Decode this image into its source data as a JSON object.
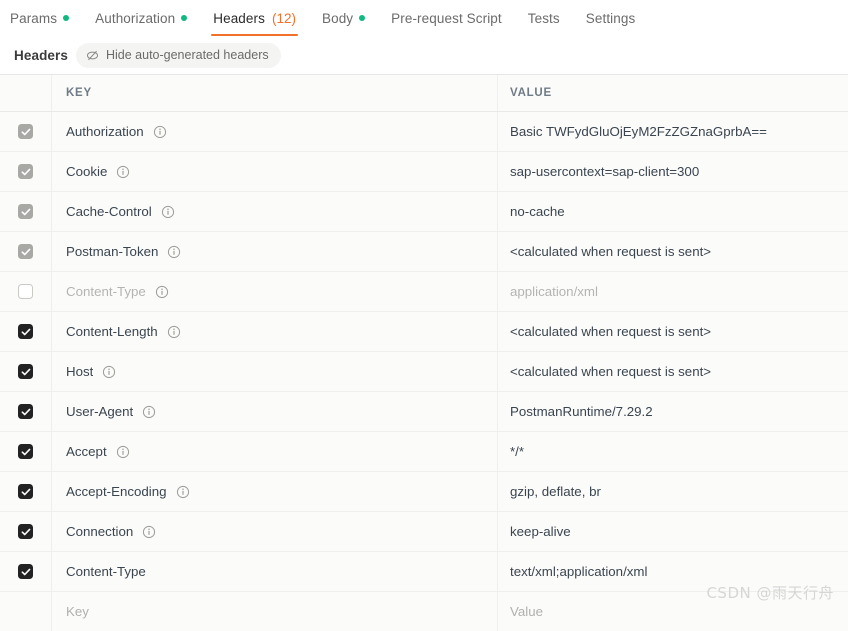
{
  "tabs": [
    {
      "label": "Params",
      "dot": true,
      "active": false,
      "count": ""
    },
    {
      "label": "Authorization",
      "dot": true,
      "active": false,
      "count": ""
    },
    {
      "label": "Headers",
      "dot": false,
      "active": true,
      "count": "(12)"
    },
    {
      "label": "Body",
      "dot": true,
      "active": false,
      "count": ""
    },
    {
      "label": "Pre-request Script",
      "dot": false,
      "active": false,
      "count": ""
    },
    {
      "label": "Tests",
      "dot": false,
      "active": false,
      "count": ""
    },
    {
      "label": "Settings",
      "dot": false,
      "active": false,
      "count": ""
    }
  ],
  "subbar": {
    "title": "Headers",
    "toggle_label": "Hide auto-generated headers",
    "toggle_icon": "eye-off-icon"
  },
  "table": {
    "columns": {
      "key": "KEY",
      "value": "VALUE"
    },
    "placeholder_row": {
      "key": "Key",
      "value": "Value"
    },
    "rows": [
      {
        "checked": true,
        "style": "grey",
        "key": "Authorization",
        "info": true,
        "value": "Basic TWFydGluOjEyM2FzZGZnaGprbA==",
        "dim": false
      },
      {
        "checked": true,
        "style": "grey",
        "key": "Cookie",
        "info": true,
        "value": "sap-usercontext=sap-client=300",
        "dim": false
      },
      {
        "checked": true,
        "style": "grey",
        "key": "Cache-Control",
        "info": true,
        "value": "no-cache",
        "dim": false
      },
      {
        "checked": true,
        "style": "grey",
        "key": "Postman-Token",
        "info": true,
        "value": "<calculated when request is sent>",
        "dim": false
      },
      {
        "checked": false,
        "style": "off",
        "key": "Content-Type",
        "info": true,
        "value": "application/xml",
        "dim": true
      },
      {
        "checked": true,
        "style": "dark",
        "key": "Content-Length",
        "info": true,
        "value": "<calculated when request is sent>",
        "dim": false
      },
      {
        "checked": true,
        "style": "dark",
        "key": "Host",
        "info": true,
        "value": "<calculated when request is sent>",
        "dim": false
      },
      {
        "checked": true,
        "style": "dark",
        "key": "User-Agent",
        "info": true,
        "value": "PostmanRuntime/7.29.2",
        "dim": false
      },
      {
        "checked": true,
        "style": "dark",
        "key": "Accept",
        "info": true,
        "value": "*/*",
        "dim": false
      },
      {
        "checked": true,
        "style": "dark",
        "key": "Accept-Encoding",
        "info": true,
        "value": "gzip, deflate, br",
        "dim": false
      },
      {
        "checked": true,
        "style": "dark",
        "key": "Connection",
        "info": true,
        "value": "keep-alive",
        "dim": false
      },
      {
        "checked": true,
        "style": "dark",
        "key": "Content-Type",
        "info": false,
        "value": "text/xml;application/xml",
        "dim": false
      }
    ]
  },
  "watermark": "CSDN @雨天行舟",
  "colors": {
    "accent": "#f1712a",
    "dot": "#10b981",
    "row_bg": "#fbfbf9",
    "text": "#3a4550"
  }
}
